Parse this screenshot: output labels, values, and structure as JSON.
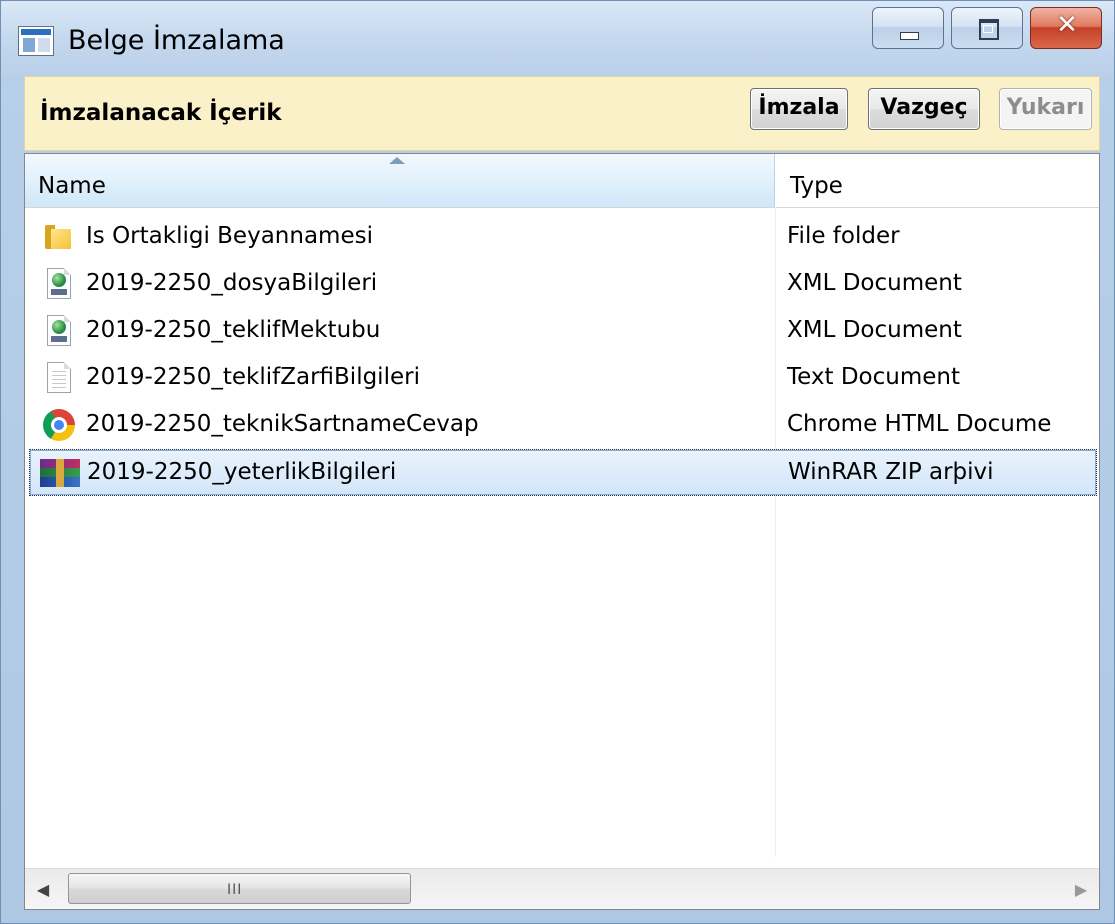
{
  "window": {
    "title": "Belge İmzalama",
    "controls": {
      "minimize": "minimize-icon",
      "maximize": "maximize-icon",
      "close": "close-icon",
      "close_glyph": "✕"
    }
  },
  "toolbar": {
    "title": "İmzalanacak İçerik",
    "sign_label": "İmzala",
    "cancel_label": "Vazgeç",
    "up_label": "Yukarı"
  },
  "list": {
    "columns": [
      {
        "label": "Name",
        "sorted": "ascending"
      },
      {
        "label": "Type"
      }
    ],
    "rows": [
      {
        "name": "Is Ortakligi Beyannamesi",
        "type": "File folder",
        "icon": "folder-icon",
        "selected": false
      },
      {
        "name": "2019-2250_dosyaBilgileri",
        "type": "XML Document",
        "icon": "xml-document-icon",
        "selected": false
      },
      {
        "name": "2019-2250_teklifMektubu",
        "type": "XML Document",
        "icon": "xml-document-icon",
        "selected": false
      },
      {
        "name": "2019-2250_teklifZarfiBilgileri",
        "type": "Text Document",
        "icon": "text-document-icon",
        "selected": false
      },
      {
        "name": "2019-2250_teknikSartnameCevap",
        "type": "Chrome HTML Docume",
        "icon": "chrome-icon",
        "selected": false
      },
      {
        "name": "2019-2250_yeterlikBilgileri",
        "type": "WinRAR ZIP arþivi",
        "icon": "winrar-archive-icon",
        "selected": true
      }
    ]
  },
  "scrollbar": {
    "left_arrow": "◀",
    "right_arrow": "▶",
    "grip": "III"
  },
  "colors": {
    "toolbar_bg": "#fbf1c9",
    "selection": "#d3e6fa",
    "close_button": "#c5412a"
  }
}
